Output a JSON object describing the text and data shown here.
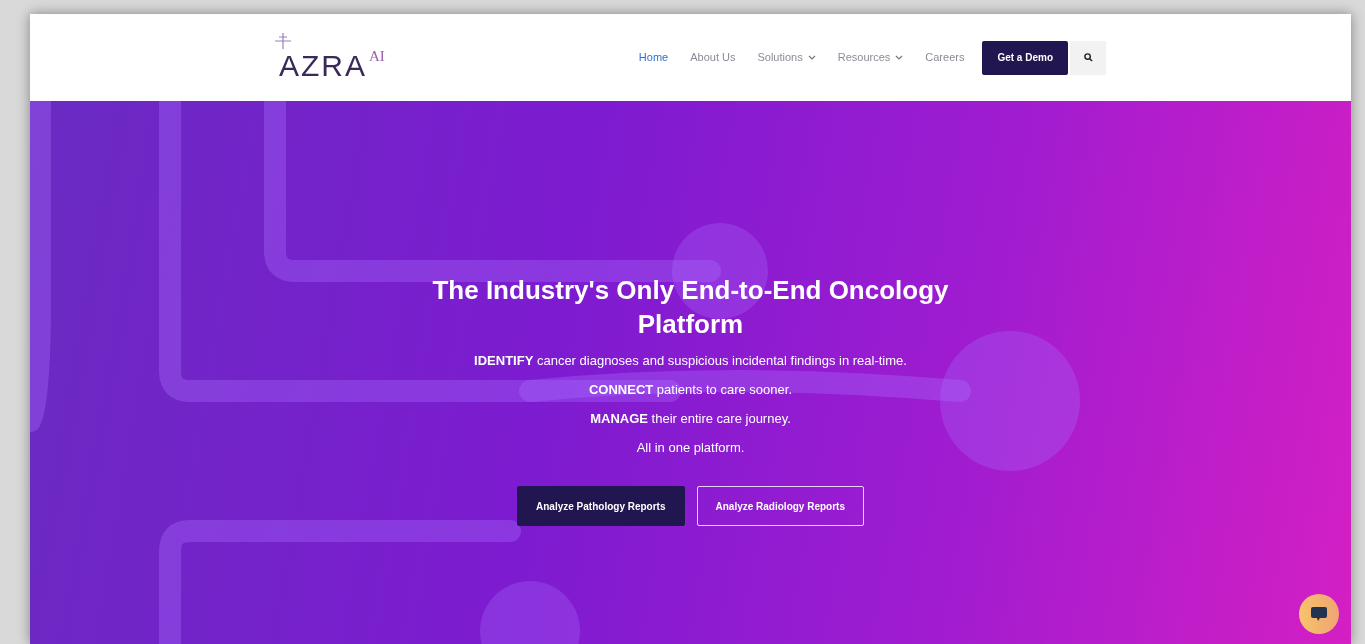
{
  "logo": {
    "text": "AZRA",
    "superscript": "AI"
  },
  "nav": [
    {
      "label": "Home",
      "selected": true,
      "dropdown": false
    },
    {
      "label": "About Us",
      "selected": false,
      "dropdown": false
    },
    {
      "label": "Solutions",
      "selected": false,
      "dropdown": true
    },
    {
      "label": "Resources",
      "selected": false,
      "dropdown": true
    },
    {
      "label": "Careers",
      "selected": false,
      "dropdown": false
    }
  ],
  "cta_button": "Get a Demo",
  "hero": {
    "title": "The Industry's Only End-to-End Oncology Platform",
    "lines": [
      "**IDENTIFY** cancer diagnoses and suspicious incidental findings in real-time.",
      "**CONNECT** patients to care sooner.",
      "**MANAGE** their entire care journey.",
      "All in one platform."
    ],
    "buttons": [
      {
        "label": "Analyze Pathology Reports",
        "kind": "primary"
      },
      {
        "label": "Analyze Radiology Reports",
        "kind": "outline"
      }
    ]
  }
}
